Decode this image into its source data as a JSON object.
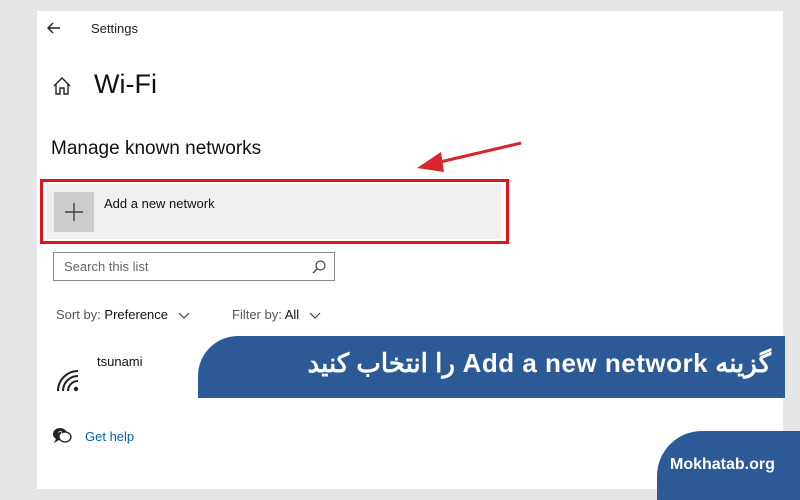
{
  "window": {
    "title": "Settings"
  },
  "page": {
    "title": "Wi-Fi"
  },
  "section": {
    "title": "Manage known networks"
  },
  "add_network": {
    "label": "Add a new network"
  },
  "search": {
    "placeholder": "Search this list",
    "value": ""
  },
  "sort": {
    "label": "Sort by:",
    "value": "Preference"
  },
  "filter": {
    "label": "Filter by:",
    "value": "All"
  },
  "networks": [
    {
      "name": "tsunami"
    }
  ],
  "help": {
    "label": "Get help"
  },
  "overlay": {
    "banner_text": "گزینه Add a new network را انتخاب کنید",
    "watermark": "Mokhatab.org"
  },
  "colors": {
    "highlight": "#e3121f",
    "banner": "#2b5a97",
    "link": "#0063b1"
  },
  "icons": [
    "back-arrow-icon",
    "home-icon",
    "plus-icon",
    "search-icon",
    "chevron-down-icon",
    "wifi-icon",
    "help-icon"
  ]
}
